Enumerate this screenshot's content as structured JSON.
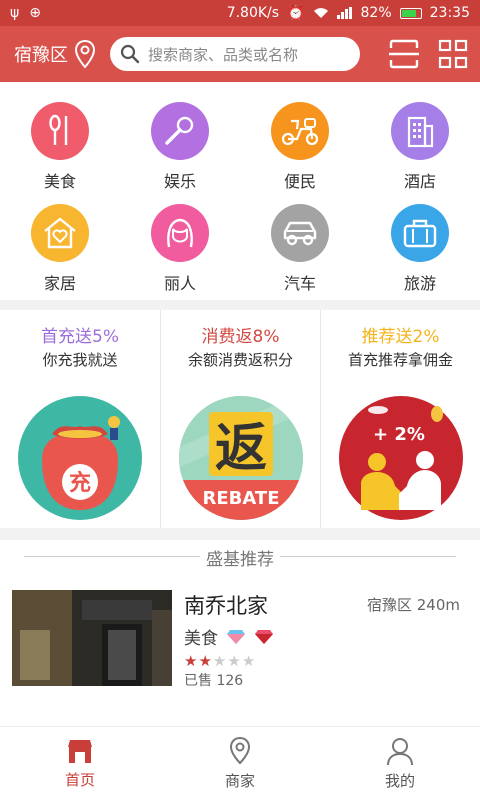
{
  "status_bar": {
    "speed": "7.80K/s",
    "battery": "82%",
    "battery_level": 0.82,
    "time": "23:35"
  },
  "header": {
    "location": "宿豫区",
    "search_placeholder": "搜索商家、品类或名称"
  },
  "categories": [
    {
      "label": "美食",
      "icon": "utensils-icon",
      "color": "#f05c6b"
    },
    {
      "label": "娱乐",
      "icon": "microphone-icon",
      "color": "#b370e0"
    },
    {
      "label": "便民",
      "icon": "scooter-icon",
      "color": "#f7941d"
    },
    {
      "label": "酒店",
      "icon": "building-icon",
      "color": "#a57ee8"
    },
    {
      "label": "家居",
      "icon": "house-heart-icon",
      "color": "#f8b52f"
    },
    {
      "label": "丽人",
      "icon": "woman-icon",
      "color": "#f05c9e"
    },
    {
      "label": "汽车",
      "icon": "car-icon",
      "color": "#a3a3a3"
    },
    {
      "label": "旅游",
      "icon": "suitcase-icon",
      "color": "#3aa6e8"
    }
  ],
  "promos": [
    {
      "title": "首充送5%",
      "subtitle": "你充我就送",
      "color": "#9b6ddc",
      "badge": "充"
    },
    {
      "title": "消费返8%",
      "subtitle": "余额消费返积分",
      "color": "#d24a43",
      "badge": "返",
      "rebate": "REBATE"
    },
    {
      "title": "推荐送2%",
      "subtitle": "首充推荐拿佣金",
      "color": "#f4b31a",
      "badge": "+ 2%"
    }
  ],
  "recommend": {
    "title": "盛基推荐",
    "shops": [
      {
        "name": "南乔北家",
        "category": "美食",
        "district": "宿豫区 240m",
        "rating": 2,
        "max_rating": 5,
        "sold": "已售 126"
      }
    ]
  },
  "tabbar": [
    {
      "label": "首页",
      "icon": "shop-icon",
      "active": true
    },
    {
      "label": "商家",
      "icon": "location-pin-icon",
      "active": false
    },
    {
      "label": "我的",
      "icon": "user-icon",
      "active": false
    }
  ]
}
